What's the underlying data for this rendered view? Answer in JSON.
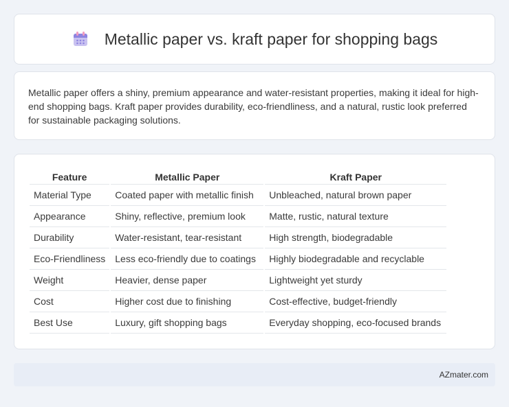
{
  "header": {
    "title": "Metallic paper vs. kraft paper for shopping bags",
    "icon": "calendar-icon"
  },
  "intro": {
    "text": "Metallic paper offers a shiny, premium appearance and water-resistant properties, making it ideal for high-end shopping bags. Kraft paper provides durability, eco-friendliness, and a natural, rustic look preferred for sustainable packaging solutions."
  },
  "table": {
    "headers": [
      "Feature",
      "Metallic Paper",
      "Kraft Paper"
    ],
    "rows": [
      [
        "Material Type",
        "Coated paper with metallic finish",
        "Unbleached, natural brown paper"
      ],
      [
        "Appearance",
        "Shiny, reflective, premium look",
        "Matte, rustic, natural texture"
      ],
      [
        "Durability",
        "Water-resistant, tear-resistant",
        "High strength, biodegradable"
      ],
      [
        "Eco-Friendliness",
        "Less eco-friendly due to coatings",
        "Highly biodegradable and recyclable"
      ],
      [
        "Weight",
        "Heavier, dense paper",
        "Lightweight yet sturdy"
      ],
      [
        "Cost",
        "Higher cost due to finishing",
        "Cost-effective, budget-friendly"
      ],
      [
        "Best Use",
        "Luxury, gift shopping bags",
        "Everyday shopping, eco-focused brands"
      ]
    ]
  },
  "footer": {
    "text": "AZmater.com"
  }
}
